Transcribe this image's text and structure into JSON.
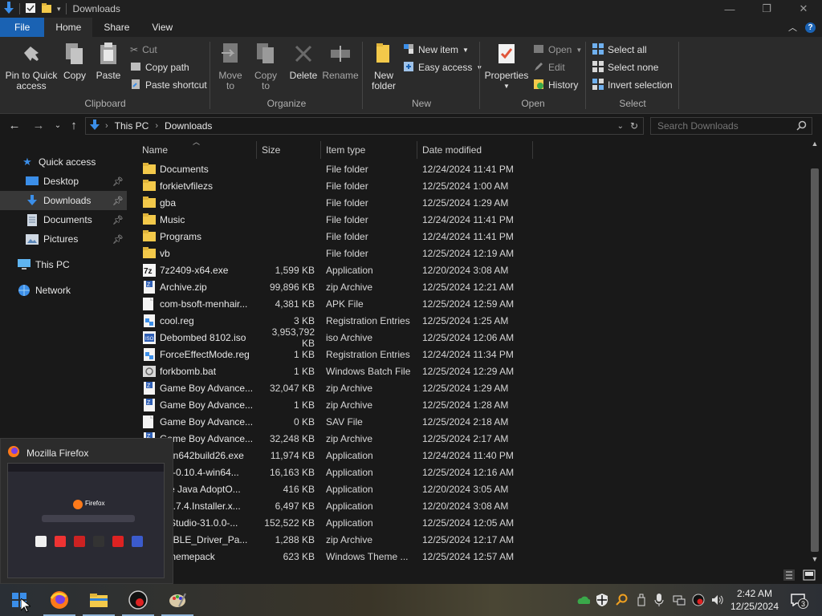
{
  "window": {
    "title": "Downloads",
    "controls": {
      "minimize": "—",
      "maximize": "❐",
      "close": "✕"
    }
  },
  "tabs": [
    {
      "label": "File"
    },
    {
      "label": "Home"
    },
    {
      "label": "Share"
    },
    {
      "label": "View"
    }
  ],
  "ribbon": {
    "clipboard": {
      "label": "Clipboard",
      "pin_quick_access": "Pin to Quick access",
      "copy": "Copy",
      "paste": "Paste",
      "cut": "Cut",
      "copy_path": "Copy path",
      "paste_shortcut": "Paste shortcut"
    },
    "organize": {
      "label": "Organize",
      "move_to": "Move to",
      "copy_to": "Copy to",
      "delete": "Delete",
      "rename": "Rename"
    },
    "new": {
      "label": "New",
      "new_folder": "New folder",
      "new_item": "New item",
      "easy_access": "Easy access"
    },
    "open": {
      "label": "Open",
      "properties": "Properties",
      "open": "Open",
      "edit": "Edit",
      "history": "History"
    },
    "select": {
      "label": "Select",
      "select_all": "Select all",
      "select_none": "Select none",
      "invert_selection": "Invert selection"
    }
  },
  "address": {
    "crumbs": [
      "This PC",
      "Downloads"
    ],
    "search_placeholder": "Search Downloads"
  },
  "nav": {
    "quick_access": "Quick access",
    "desktop": "Desktop",
    "downloads": "Downloads",
    "documents": "Documents",
    "pictures": "Pictures",
    "this_pc": "This PC",
    "network": "Network"
  },
  "columns": {
    "name": "Name",
    "size": "Size",
    "type": "Item type",
    "date": "Date modified"
  },
  "files": [
    {
      "name": "Documents",
      "size": "",
      "type": "File folder",
      "date": "12/24/2024 11:41 PM",
      "icon": "folder"
    },
    {
      "name": "forkietvfilezs",
      "size": "",
      "type": "File folder",
      "date": "12/25/2024 1:00 AM",
      "icon": "folder"
    },
    {
      "name": "gba",
      "size": "",
      "type": "File folder",
      "date": "12/25/2024 1:29 AM",
      "icon": "folder"
    },
    {
      "name": "Music",
      "size": "",
      "type": "File folder",
      "date": "12/24/2024 11:41 PM",
      "icon": "folder"
    },
    {
      "name": "Programs",
      "size": "",
      "type": "File folder",
      "date": "12/24/2024 11:41 PM",
      "icon": "folder"
    },
    {
      "name": "vb",
      "size": "",
      "type": "File folder",
      "date": "12/25/2024 12:19 AM",
      "icon": "folder"
    },
    {
      "name": "7z2409-x64.exe",
      "size": "1,599 KB",
      "type": "Application",
      "date": "12/20/2024 3:08 AM",
      "icon": "7z"
    },
    {
      "name": "Archive.zip",
      "size": "99,896 KB",
      "type": "zip Archive",
      "date": "12/25/2024 12:21 AM",
      "icon": "zip"
    },
    {
      "name": "com-bsoft-menhair...",
      "size": "4,381 KB",
      "type": "APK File",
      "date": "12/25/2024 12:59 AM",
      "icon": "file"
    },
    {
      "name": "cool.reg",
      "size": "3 KB",
      "type": "Registration Entries",
      "date": "12/25/2024 1:25 AM",
      "icon": "reg"
    },
    {
      "name": "Debombed 8102.iso",
      "size": "3,953,792 KB",
      "type": "iso Archive",
      "date": "12/25/2024 12:06 AM",
      "icon": "iso"
    },
    {
      "name": "ForceEffectMode.reg",
      "size": "1 KB",
      "type": "Registration Entries",
      "date": "12/24/2024 11:34 PM",
      "icon": "reg"
    },
    {
      "name": "forkbomb.bat",
      "size": "1 KB",
      "type": "Windows Batch File",
      "date": "12/25/2024 12:29 AM",
      "icon": "bat"
    },
    {
      "name": "Game Boy Advance...",
      "size": "32,047 KB",
      "type": "zip Archive",
      "date": "12/25/2024 1:29 AM",
      "icon": "zip"
    },
    {
      "name": "Game Boy Advance...",
      "size": "1 KB",
      "type": "zip Archive",
      "date": "12/25/2024 1:28 AM",
      "icon": "zip"
    },
    {
      "name": "Game Boy Advance...",
      "size": "0 KB",
      "type": "SAV File",
      "date": "12/25/2024 2:18 AM",
      "icon": "file"
    },
    {
      "name": "Game Boy Advance...",
      "size": "32,248 KB",
      "type": "zip Archive",
      "date": "12/25/2024 2:17 AM",
      "icon": "zip"
    },
    {
      "name": "man642build26.exe",
      "size": "11,974 KB",
      "type": "Application",
      "date": "12/24/2024 11:40 PM",
      "icon": "exe"
    },
    {
      "name": "BA-0.10.4-win64...",
      "size": "16,163 KB",
      "type": "Application",
      "date": "12/25/2024 12:16 AM",
      "icon": "exe"
    },
    {
      "name": "site Java AdoptO...",
      "size": "416 KB",
      "type": "Application",
      "date": "12/20/2024 3:05 AM",
      "icon": "exe"
    },
    {
      "name": "b.8.7.4.Installer.x...",
      "size": "6,497 KB",
      "type": "Application",
      "date": "12/20/2024 3:08 AM",
      "icon": "exe"
    },
    {
      "name": "S-Studio-31.0.0-...",
      "size": "152,522 KB",
      "type": "Application",
      "date": "12/25/2024 12:05 AM",
      "icon": "exe"
    },
    {
      "name": "CABLE_Driver_Pa...",
      "size": "1,288 KB",
      "type": "zip Archive",
      "date": "12/25/2024 12:17 AM",
      "icon": "zip"
    },
    {
      "name": "7.themepack",
      "size": "623 KB",
      "type": "Windows Theme ...",
      "date": "12/25/2024 12:57 AM",
      "icon": "file"
    }
  ],
  "thumbnail": {
    "title": "Mozilla Firefox",
    "preview_brand": "Firefox"
  },
  "clock": {
    "time": "2:42 AM",
    "date": "12/25/2024"
  },
  "notifications": {
    "count": "3"
  },
  "colors": {
    "accent": "#1a62b3",
    "folder": "#f3c94a",
    "background": "#191919",
    "ribbon": "#2b2b2b"
  }
}
